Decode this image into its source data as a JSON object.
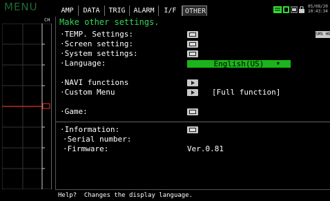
{
  "menu": {
    "title": "MENU",
    "channel_label": "CH"
  },
  "tabs": [
    {
      "label": "AMP",
      "active": false
    },
    {
      "label": "DATA",
      "active": false
    },
    {
      "label": "TRIG",
      "active": false
    },
    {
      "label": "ALARM",
      "active": false
    },
    {
      "label": "I/F",
      "active": false
    },
    {
      "label": "OTHER",
      "active": true
    }
  ],
  "status": {
    "date": "05/08/20",
    "time": "10:43:34",
    "colors": {
      "battery": "#33dd33",
      "card": "#33dd33"
    }
  },
  "content": {
    "title": "Make other settings.",
    "side_tag": "SMS HE",
    "rows": {
      "temp": "·TEMP. Settings:",
      "screen": "·Screen setting:",
      "system": "·System settings:",
      "language": "·Language:",
      "navi": "·NAVI functions",
      "custom_menu": "·Custom Menu",
      "custom_menu_value": "[Full function]",
      "game": "·Game:",
      "information": "·Information:",
      "serial": "·Serial number:",
      "firmware": "·Firmware:",
      "firmware_value": "Ver.0.81"
    },
    "language_value": "English(US)"
  },
  "help": {
    "text": "Help?  Changes the display language."
  },
  "colors": {
    "accent_green": "#33d95a",
    "select_green": "#1ab51a",
    "menu_dim": "#1f6b30"
  }
}
